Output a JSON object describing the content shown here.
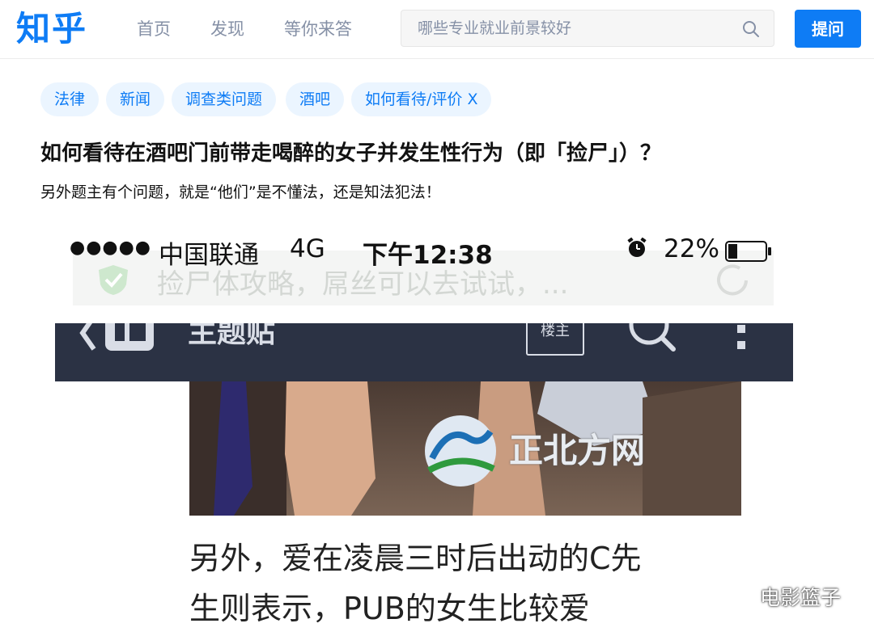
{
  "header": {
    "logo": "知乎",
    "nav": [
      "首页",
      "发现",
      "等你来答"
    ],
    "search_placeholder": "哪些专业就业前景较好",
    "ask_label": "提问"
  },
  "tags": [
    "法律",
    "新闻",
    "调查类问题",
    "酒吧",
    "如何看待/评价 X"
  ],
  "question": {
    "title": "如何看待在酒吧门前带走喝醉的女子并发生性行为（即「捡尸」）？",
    "detail": "另外题主有个问题，就是“他们”是不懂法，还是知法犯法！"
  },
  "screenshot": {
    "status": {
      "signal": "●●●●●",
      "carrier": "中国联通",
      "network": "4G",
      "time": "下午12:38",
      "battery": "22%"
    },
    "ghost_text": "捡尸体攻略，屌丝可以去试试，...",
    "app_title": "主题贴",
    "op_badge": "楼主",
    "photo_watermark": "正北方网",
    "caption_lines": [
      "另外，爱在凌晨三时后出动的C先",
      "生则表示，PUB的女生比较爱"
    ]
  },
  "watermark": "电影篮子",
  "colors": {
    "brand": "#0e7cf5",
    "tag_bg": "#ebf5ff",
    "app_bar": "#2b3244"
  }
}
